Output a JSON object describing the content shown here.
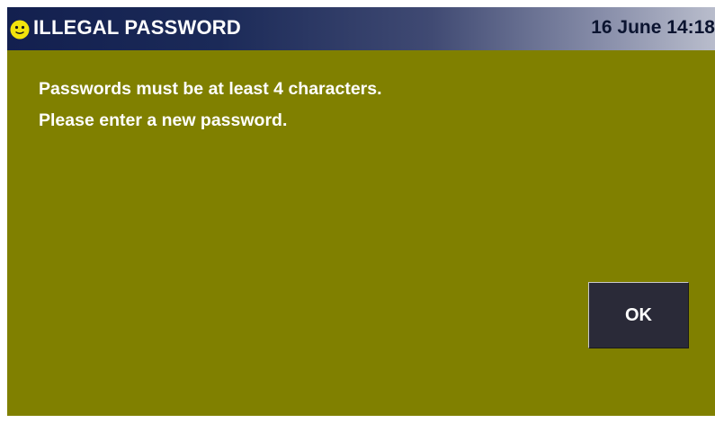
{
  "header": {
    "title": "ILLEGAL PASSWORD",
    "datetime": "16 June 14:18",
    "icon": "smiley-face-icon"
  },
  "message": {
    "line1": "Passwords must be at least 4 characters.",
    "line2": "Please enter a new password."
  },
  "actions": {
    "ok_label": "OK"
  },
  "colors": {
    "background": "#808000",
    "header_dark": "#13204f",
    "header_light": "#b9bdcc",
    "button_bg": "#2a2a38",
    "text": "#ffffff",
    "icon_yellow": "#f2e40c"
  }
}
